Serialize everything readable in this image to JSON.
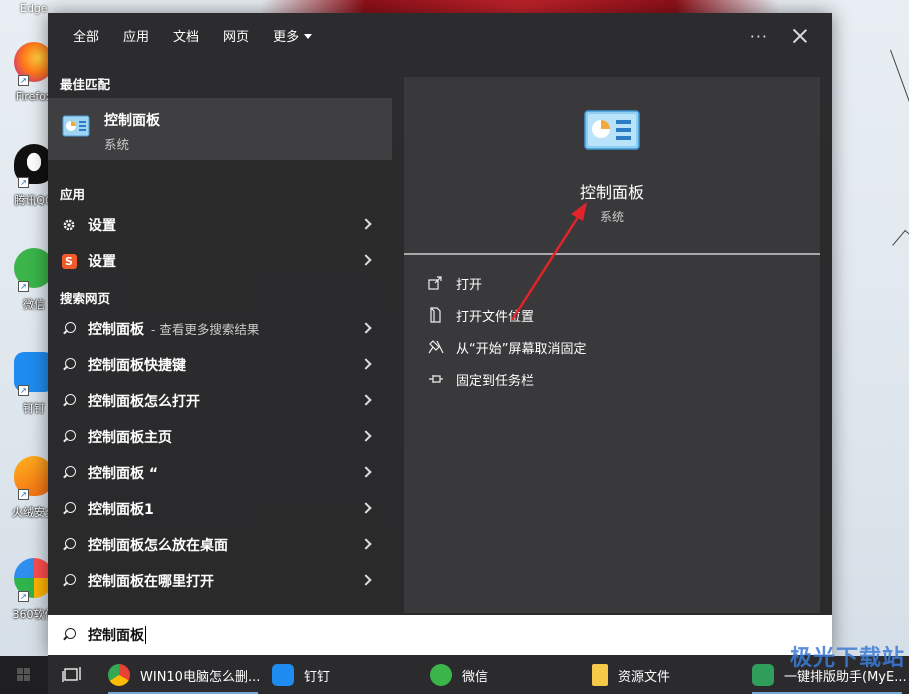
{
  "desktop": {
    "edge_label": "Edge",
    "icons": [
      {
        "label": "Firefox"
      },
      {
        "label": "腾讯QQ"
      },
      {
        "label": "微信"
      },
      {
        "label": "钉钉"
      },
      {
        "label": "火绒安全"
      },
      {
        "label": "360软件"
      }
    ]
  },
  "start_menu": {
    "tabs": [
      {
        "label": "全部"
      },
      {
        "label": "应用"
      },
      {
        "label": "文档"
      },
      {
        "label": "网页"
      },
      {
        "label": "更多"
      }
    ],
    "more_icon": "ellipsis-icon",
    "close_icon": "close-icon",
    "best_match": {
      "section": "最佳匹配",
      "name": "控制面板",
      "category": "系统"
    },
    "apps": {
      "section": "应用",
      "items": [
        {
          "label": "设置",
          "icon": "gear-icon"
        },
        {
          "label": "设置",
          "icon": "sogou-icon"
        }
      ]
    },
    "web": {
      "section": "搜索网页",
      "items": [
        {
          "label": "控制面板",
          "sub": "- 查看更多搜索结果"
        },
        {
          "label": "控制面板快捷键",
          "sub": ""
        },
        {
          "label": "控制面板怎么打开",
          "sub": ""
        },
        {
          "label": "控制面板主页",
          "sub": ""
        },
        {
          "label": "控制面板 “",
          "sub": ""
        },
        {
          "label": "控制面板1",
          "sub": ""
        },
        {
          "label": "控制面板怎么放在桌面",
          "sub": ""
        },
        {
          "label": "控制面板在哪里打开",
          "sub": ""
        }
      ]
    },
    "detail": {
      "name": "控制面板",
      "category": "系统",
      "actions": [
        {
          "label": "打开",
          "icon": "open-icon"
        },
        {
          "label": "打开文件位置",
          "icon": "file-location-icon"
        },
        {
          "label": "从“开始”屏幕取消固定",
          "icon": "unpin-icon"
        },
        {
          "label": "固定到任务栏",
          "icon": "pin-icon"
        }
      ]
    },
    "search": {
      "value": "控制面板"
    }
  },
  "taskbar": {
    "items": [
      {
        "label": "",
        "icon": "task-view-icon"
      },
      {
        "label": "WIN10电脑怎么删...",
        "icon": "chrome-icon"
      },
      {
        "label": "钉钉",
        "icon": "dingtalk-icon"
      },
      {
        "label": "微信",
        "icon": "wechat-icon"
      },
      {
        "label": "资源文件",
        "icon": "folder-icon"
      },
      {
        "label": "一键排版助手(MyE...",
        "icon": "myeditor-icon"
      }
    ]
  },
  "watermark": "极光下载站",
  "colors": {
    "menu_bg": "#2c2b2d",
    "selected_bg": "#3f3e40",
    "detail_bg": "#39383a",
    "arrow": "#e0242a"
  }
}
